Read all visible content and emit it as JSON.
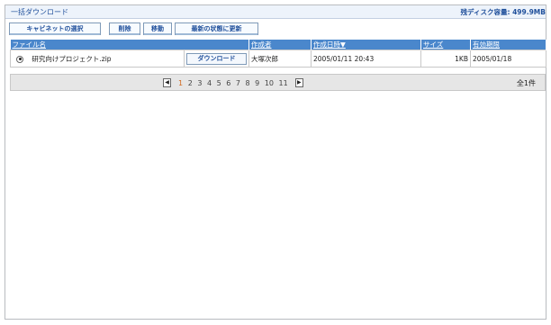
{
  "header": {
    "title": "一括ダウンロード",
    "disk_usage": "残ディスク容量: 499.9MB"
  },
  "toolbar": {
    "cabinet_label": "キャビネットの選択",
    "delete_label": "削除",
    "move_label": "移動",
    "refresh_label": "最新の状態に更新"
  },
  "table": {
    "headers": {
      "filename": "ファイル名",
      "author": "作成者",
      "created": "作成日時▼",
      "size": "サイズ",
      "expiry": "有効期限"
    },
    "rows": [
      {
        "filename": "研究向けプロジェクト.zip",
        "download_label": "ダウンロード",
        "author": "大塚次郎",
        "created": "2005/01/11 20:43",
        "size": "1KB",
        "expiry": "2005/01/18"
      }
    ]
  },
  "pager": {
    "prev_icon": "◀",
    "next_icon": "▶",
    "pages": [
      "1",
      "2",
      "3",
      "4",
      "5",
      "6",
      "7",
      "8",
      "9",
      "10",
      "11"
    ],
    "current": "1",
    "total": "全1件"
  }
}
